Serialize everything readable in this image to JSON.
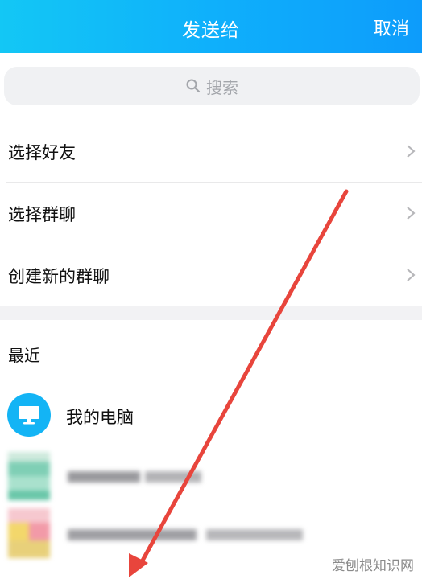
{
  "header": {
    "title": "发送给",
    "cancel_label": "取消"
  },
  "search": {
    "placeholder": "搜索",
    "icon": "search-icon"
  },
  "menu": [
    {
      "label": "选择好友",
      "icon": "chevron-right-icon"
    },
    {
      "label": "选择群聊",
      "icon": "chevron-right-icon"
    },
    {
      "label": "创建新的群聊",
      "icon": "chevron-right-icon"
    }
  ],
  "recent": {
    "title": "最近",
    "items": [
      {
        "name": "我的电脑",
        "icon": "computer-icon",
        "avatar_color": "#13b4f5"
      }
    ]
  },
  "annotation": {
    "arrow_color": "#e8453c"
  },
  "watermark": {
    "text": "爱刨根知识网"
  },
  "colors": {
    "header_gradient_start": "#13c7f5",
    "header_gradient_end": "#0d9cfb"
  }
}
